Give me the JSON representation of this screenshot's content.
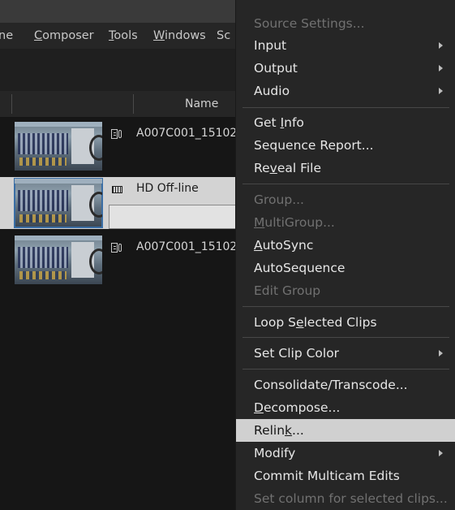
{
  "menubar": {
    "items": [
      {
        "pre": "ne",
        "u": "",
        "post": ""
      },
      {
        "pre": "",
        "u": "C",
        "post": "omposer"
      },
      {
        "pre": "",
        "u": "T",
        "post": "ools"
      },
      {
        "pre": "",
        "u": "W",
        "post": "indows"
      },
      {
        "pre": "Sc",
        "u": "",
        "post": ""
      }
    ]
  },
  "bin": {
    "column_header": "Name",
    "rows": [
      {
        "name": "A007C001_15102",
        "icon": "clip-icon",
        "selected": false
      },
      {
        "name": "HD Off-line",
        "icon": "sequence-icon",
        "selected": true
      },
      {
        "name": "A007C001_15102",
        "icon": "clip-icon",
        "selected": false
      }
    ]
  },
  "context_menu": {
    "items": [
      {
        "pre": "Source Settings...",
        "u": "",
        "post": "",
        "disabled": true,
        "submenu": false
      },
      {
        "pre": "Input",
        "u": "",
        "post": "",
        "disabled": false,
        "submenu": true
      },
      {
        "pre": "Output",
        "u": "",
        "post": "",
        "disabled": false,
        "submenu": true
      },
      {
        "pre": "Audio",
        "u": "",
        "post": "",
        "disabled": false,
        "submenu": true
      },
      {
        "pre": "Get ",
        "u": "I",
        "post": "nfo",
        "disabled": false,
        "submenu": false
      },
      {
        "pre": "Sequence Report...",
        "u": "",
        "post": "",
        "disabled": false,
        "submenu": false
      },
      {
        "pre": "Re",
        "u": "v",
        "post": "eal File",
        "disabled": false,
        "submenu": false
      },
      {
        "pre": "Group...",
        "u": "",
        "post": "",
        "disabled": true,
        "submenu": false
      },
      {
        "pre": "",
        "u": "M",
        "post": "ultiGroup...",
        "disabled": true,
        "submenu": false
      },
      {
        "pre": "",
        "u": "A",
        "post": "utoSync",
        "disabled": false,
        "submenu": false
      },
      {
        "pre": "AutoSequence",
        "u": "",
        "post": "",
        "disabled": false,
        "submenu": false
      },
      {
        "pre": "Edit Group",
        "u": "",
        "post": "",
        "disabled": true,
        "submenu": false
      },
      {
        "pre": "Loop S",
        "u": "e",
        "post": "lected Clips",
        "disabled": false,
        "submenu": false
      },
      {
        "pre": "Set Clip Color",
        "u": "",
        "post": "",
        "disabled": false,
        "submenu": true
      },
      {
        "pre": "Consolidate/Transcode...",
        "u": "",
        "post": "",
        "disabled": false,
        "submenu": false
      },
      {
        "pre": "",
        "u": "D",
        "post": "ecompose...",
        "disabled": false,
        "submenu": false
      },
      {
        "pre": "Relin",
        "u": "k",
        "post": "...",
        "disabled": false,
        "submenu": false,
        "highlighted": true
      },
      {
        "pre": "Modify",
        "u": "",
        "post": "",
        "disabled": false,
        "submenu": true
      },
      {
        "pre": "Commit Multicam Edits",
        "u": "",
        "post": "",
        "disabled": false,
        "submenu": false
      },
      {
        "pre": "Set column for selected clips...",
        "u": "",
        "post": "",
        "disabled": true,
        "submenu": false
      }
    ]
  },
  "colors": {
    "menu_bg": "#262626",
    "highlight_bg": "#d0d0d0",
    "disabled_text": "#717171",
    "selected_row_bg": "#d3d3d3"
  }
}
